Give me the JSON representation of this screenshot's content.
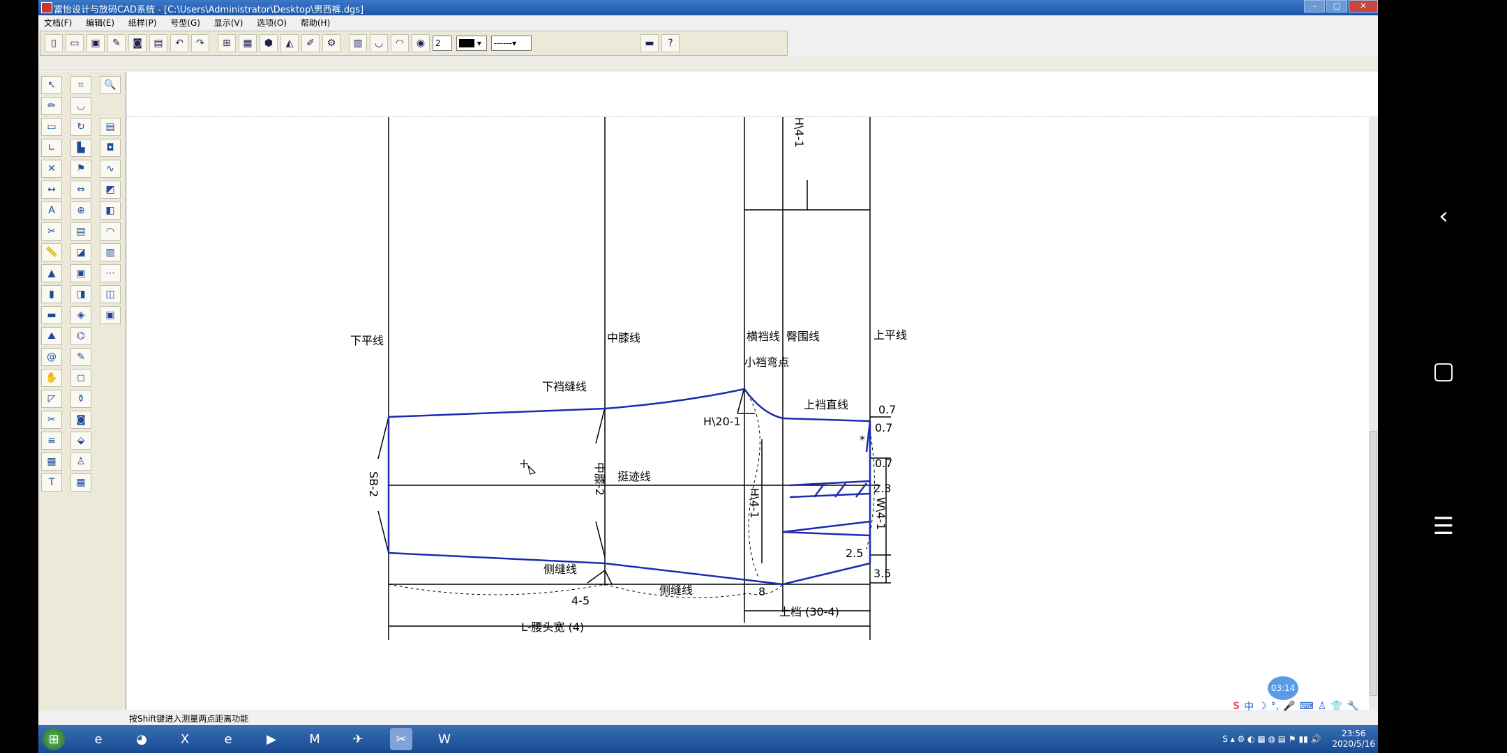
{
  "window": {
    "title": "富怡设计与放码CAD系统 - [C:\\Users\\Administrator\\Desktop\\男西裤.dgs]"
  },
  "menu": [
    "文档(F)",
    "编辑(E)",
    "纸样(P)",
    "号型(G)",
    "显示(V)",
    "选项(O)",
    "帮助(H)"
  ],
  "toolbar": {
    "line_width_value": "2",
    "line_style_value": "------"
  },
  "drawing": {
    "labels": {
      "xia_ping": "下平线",
      "zhong_xi": "中膝线",
      "heng_dang": "横裆线",
      "tun_wei": "臀围线",
      "shang_ping": "上平线",
      "xiao_dang_wan": "小裆弯点",
      "xia_dang_feng": "下裆缝线",
      "shang_dang_zhi": "上裆直线",
      "ce_feng_1": "侧缝线",
      "ce_feng_2": "侧缝线",
      "ting_ji": "挺迹线",
      "sb2": "SB-2",
      "zhong_xi_2": "中膝-2",
      "h20": "H\\20-1",
      "h4_top": "H\\4-1",
      "h4_mid": "H\\4-1",
      "w4": "W\\4-1",
      "v07a": "0.7",
      "v07b": "0.7",
      "v07c": "0.7",
      "v23": "2.3",
      "v25": "2.5",
      "v35": "3.5",
      "v45": "4-5",
      "v8": "8",
      "star": "*",
      "shang_dang_dim": "上档 (30-4)",
      "length_dim": "L-腰头宽 (4)"
    }
  },
  "status": {
    "message": "按Shift键进入测量两点距离功能"
  },
  "overlay": {
    "timer": "03:14"
  },
  "tray": {
    "time": "23:56",
    "date": "2020/5/16"
  }
}
